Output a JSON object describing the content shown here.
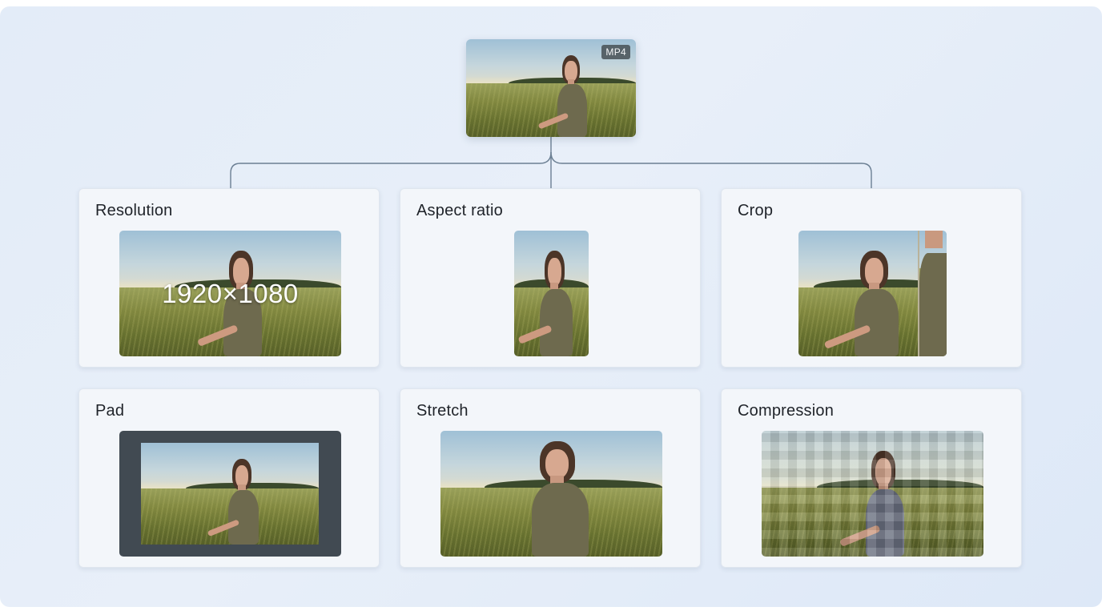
{
  "source": {
    "badge": "MP4"
  },
  "cards": [
    {
      "title": "Resolution",
      "overlay": "1920×1080"
    },
    {
      "title": "Aspect ratio"
    },
    {
      "title": "Crop"
    },
    {
      "title": "Pad"
    },
    {
      "title": "Stretch"
    },
    {
      "title": "Compression"
    }
  ],
  "colors": {
    "connector": "#6b7f93",
    "pad_frame": "#414a52"
  }
}
